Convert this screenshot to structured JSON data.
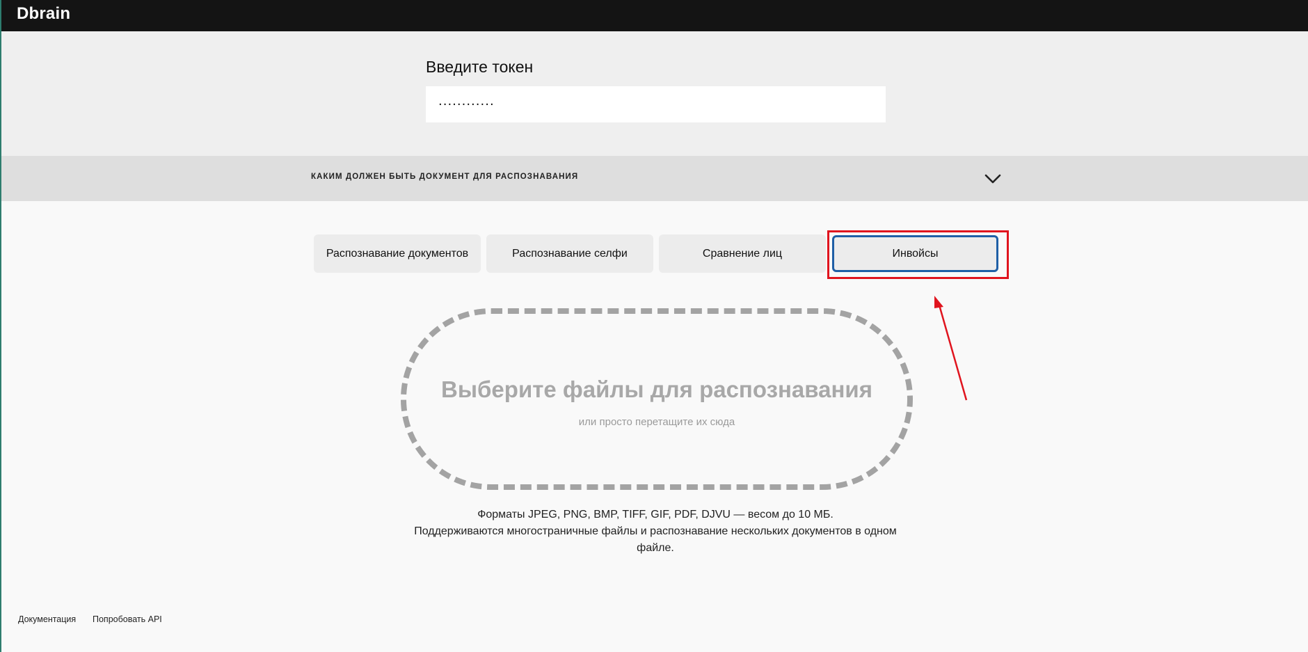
{
  "header": {
    "logo": "Dbrain"
  },
  "token": {
    "label": "Введите токен",
    "value": "············"
  },
  "accordion": {
    "title": "КАКИМ ДОЛЖЕН БЫТЬ ДОКУМЕНТ ДЛЯ РАСПОЗНАВАНИЯ",
    "icon": "chevron-down-icon"
  },
  "tabs": [
    {
      "label": "Распознавание документов"
    },
    {
      "label": "Распознавание селфи"
    },
    {
      "label": "Сравнение лиц"
    },
    {
      "label": "Инвойсы",
      "selected": true
    }
  ],
  "dropzone": {
    "title": "Выберите файлы для распознавания",
    "subtitle": "или просто перетащите их сюда"
  },
  "formats": {
    "line1": "Форматы JPEG, PNG, BMP, TIFF, GIF, PDF, DJVU — весом до 10 МБ.",
    "line2": "Поддерживаются многостраничные файлы и распознавание нескольких документов в одном",
    "line3": "файле."
  },
  "footer": {
    "docs": "Документация",
    "api": "Попробовать API"
  },
  "colors": {
    "header_bg": "#141414",
    "selected_tab_border": "#1f5fa6",
    "annotation_red": "#e0141e"
  }
}
